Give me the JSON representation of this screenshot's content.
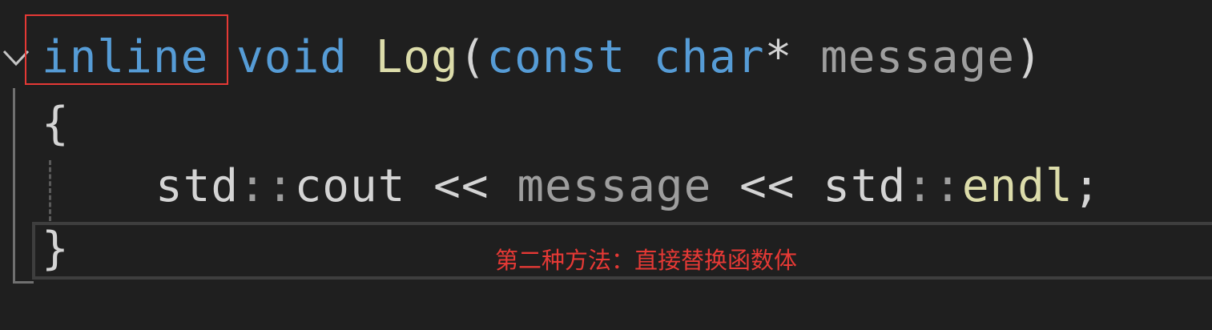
{
  "code": {
    "line1": {
      "keyword_inline": "inline",
      "keyword_void": "void",
      "function_name": "Log",
      "open_paren": "(",
      "keyword_const": "const",
      "keyword_char": "char",
      "pointer": "*",
      "param_name": "message",
      "close_paren": ")"
    },
    "line2": {
      "open_brace": "{"
    },
    "line3": {
      "std1": "std",
      "scope1": "::",
      "cout": "cout",
      "op1": "<<",
      "message": "message",
      "op2": "<<",
      "std2": "std",
      "scope2": "::",
      "endl": "endl",
      "semicolon": ";"
    },
    "line4": {
      "close_brace": "}"
    }
  },
  "annotation": {
    "text": "第二种方法：直接替换函数体"
  },
  "colors": {
    "background": "#1f1f1f",
    "keyword": "#569cd6",
    "function": "#dcdcaa",
    "parameter": "#9e9e9e",
    "default_text": "#d4d4d4",
    "highlight_red": "#e53935"
  },
  "icons": {
    "fold": "chevron-down-icon"
  }
}
